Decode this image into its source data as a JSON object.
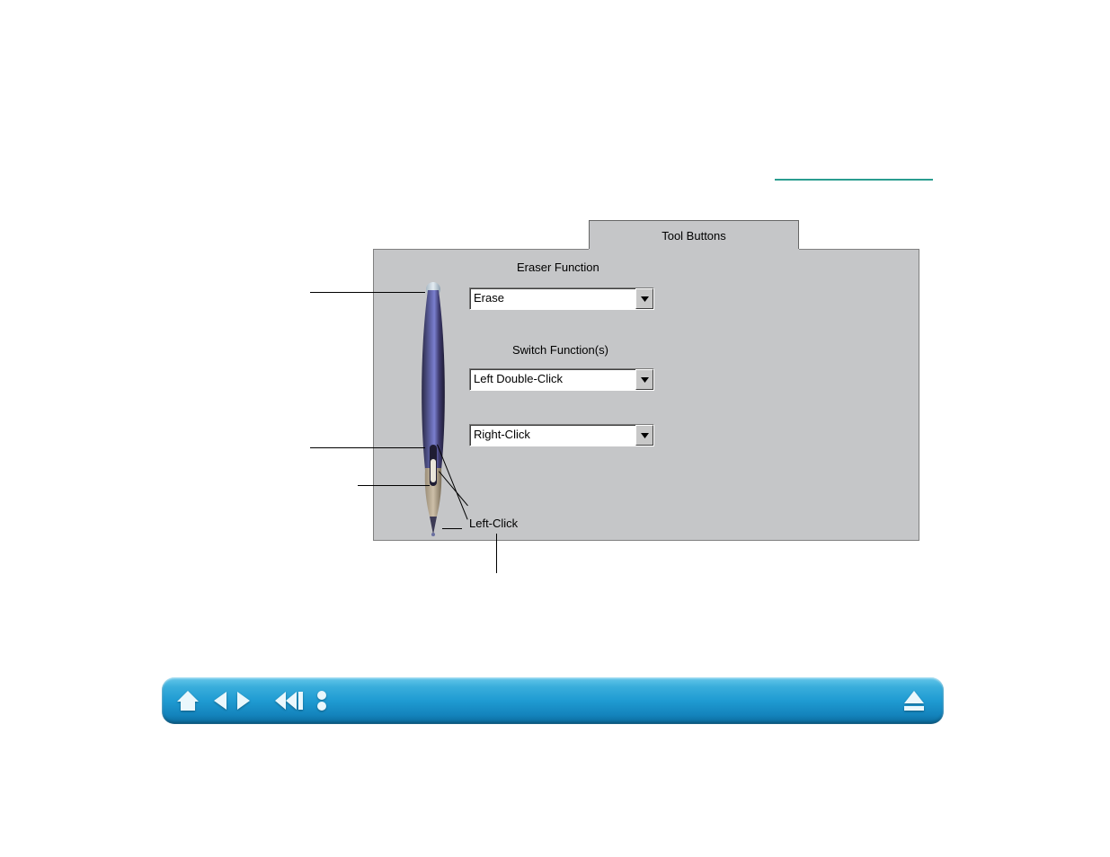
{
  "tab_label": "Tool Buttons",
  "eraser_section_label": "Eraser Function",
  "switch_section_label": "Switch Function(s)",
  "tip_label": "Left-Click",
  "dropdowns": {
    "eraser": "Erase",
    "upper_switch": "Left Double-Click",
    "lower_switch": "Right-Click"
  },
  "nav": {
    "home": "home",
    "prev": "previous page",
    "next": "next page",
    "first": "first page",
    "toc": "contents/index",
    "eject": "eject/top"
  }
}
